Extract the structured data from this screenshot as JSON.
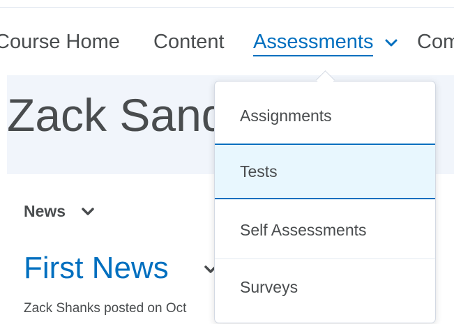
{
  "nav": {
    "items": [
      {
        "label": "Course Home"
      },
      {
        "label": "Content"
      },
      {
        "label": "Assessments"
      },
      {
        "label": "Com"
      }
    ]
  },
  "course": {
    "title": "Zack Sandb"
  },
  "dropdown": {
    "items": [
      {
        "label": "Assignments"
      },
      {
        "label": "Tests",
        "selected": true
      },
      {
        "label": "Self Assessments"
      },
      {
        "label": "Surveys"
      }
    ]
  },
  "news": {
    "widget_title": "News",
    "item_title": "First News",
    "meta": "Zack Shanks posted on Oct"
  },
  "colors": {
    "accent": "#006fbf",
    "text": "#494c4e",
    "banner_bg": "#f1f5fb",
    "selected_bg": "#e8f7fe"
  },
  "icons": {
    "assessments_chevron": "chevron-down-icon",
    "news_chevron": "chevron-down-icon",
    "item_chevron": "chevron-down-icon"
  }
}
